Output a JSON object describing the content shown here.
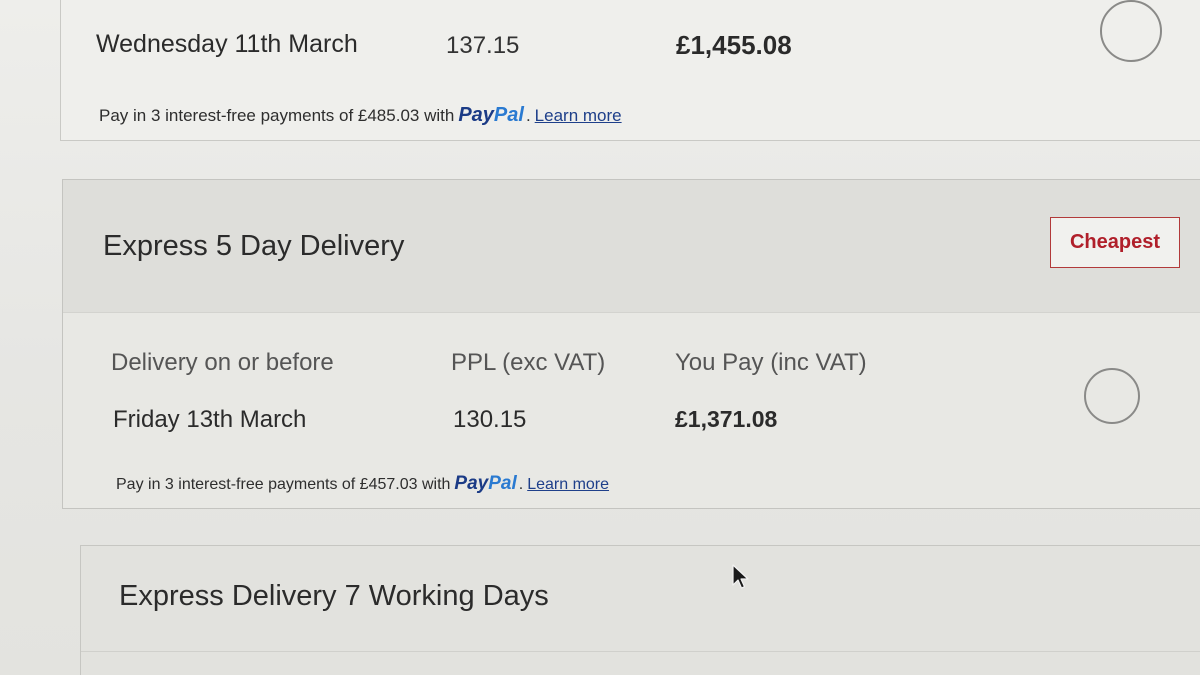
{
  "option_top": {
    "date": "Wednesday 11th March",
    "ppl": "137.15",
    "you_pay": "£1,455.08",
    "paypal": {
      "prefix": "Pay in 3 interest-free payments of £485.03 with",
      "logo_a": "Pay",
      "logo_b": "Pal",
      "suffix": ".",
      "learn_more": "Learn more"
    }
  },
  "option_express5": {
    "title": "Express 5 Day Delivery",
    "badge": "Cheapest",
    "headers": {
      "delivery": "Delivery on or before",
      "ppl": "PPL (exc VAT)",
      "you_pay": "You Pay (inc VAT)"
    },
    "date": "Friday 13th March",
    "ppl": "130.15",
    "you_pay": "£1,371.08",
    "paypal": {
      "prefix": "Pay in 3 interest-free payments of £457.03 with",
      "logo_a": "Pay",
      "logo_b": "Pal",
      "suffix": ".",
      "learn_more": "Learn more"
    }
  },
  "option_express7": {
    "title": "Express Delivery 7 Working Days"
  },
  "colors": {
    "badge_red": "#b01f2a",
    "paypal_dark": "#1b3b86",
    "paypal_light": "#2a7ad1",
    "link": "#1e3f8a"
  },
  "icons": {
    "radio": "radio-button-icon",
    "cursor": "mouse-pointer-icon"
  }
}
